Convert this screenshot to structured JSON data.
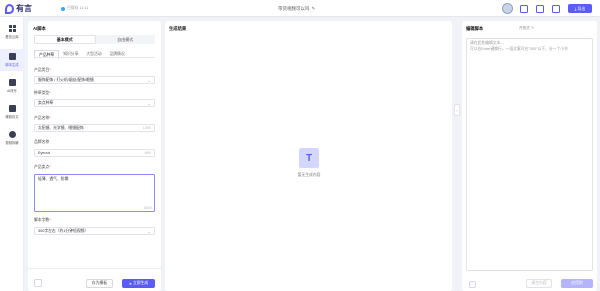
{
  "app": {
    "logo_text": "有言",
    "saved_status": "已保存 11:11",
    "doc_title": "带货视频可以吗",
    "export_label": "导出"
  },
  "nav": [
    {
      "label": "看剪云库",
      "icon": "grid-icon",
      "active": false
    },
    {
      "label": "脚本生成",
      "icon": "script-icon",
      "active": true
    },
    {
      "label": "AI改写",
      "icon": "ai-rewrite-icon",
      "active": false
    },
    {
      "label": "爆款拆文",
      "icon": "video-icon",
      "active": false
    },
    {
      "label": "视频拆解",
      "icon": "analyze-icon",
      "active": false
    }
  ],
  "form": {
    "title": "AI脚本",
    "modes": [
      "基本模式",
      "自由模式"
    ],
    "active_mode": 0,
    "tabs": [
      "产品种草",
      "知识分享",
      "大型活动",
      "品牌情况"
    ],
    "active_tab": 0,
    "fields": {
      "category": {
        "label": "产品类目",
        "required": true,
        "value": "服饰配饰 / 打火机/烟丝/配饰/眼镜"
      },
      "type": {
        "label": "种草类型",
        "required": true,
        "value": "卖点种草"
      },
      "name": {
        "label": "产品名称",
        "required": true,
        "value": "太阳镜、光学镜、眼镜配饰",
        "count": "12/50"
      },
      "brand": {
        "label": "品牌名称",
        "required": false,
        "value": "Eyeout",
        "count": "6/50"
      },
      "selling": {
        "label": "产品卖点",
        "required": true,
        "value": "轻薄、透气、防雾",
        "count": "8/200"
      },
      "length": {
        "label": "脚本字数",
        "required": true,
        "value": "300字左右（约1分钟短视频）"
      }
    },
    "btn_template": "存为模板",
    "btn_generate": "立即生成"
  },
  "result": {
    "title": "生成结果",
    "empty_text": "暂无生成内容",
    "empty_icon": "T"
  },
  "editor": {
    "title": "编辑脚本",
    "version": "开放式",
    "placeholder_line1": "请在此处编辑文本...",
    "placeholder_line2": "可以在Enter键换行，一段文案可在\"300\"以下，分一个小节",
    "btn_a": "清空内容",
    "btn_b": "应用到",
    "accent": "#5b5cf6"
  }
}
